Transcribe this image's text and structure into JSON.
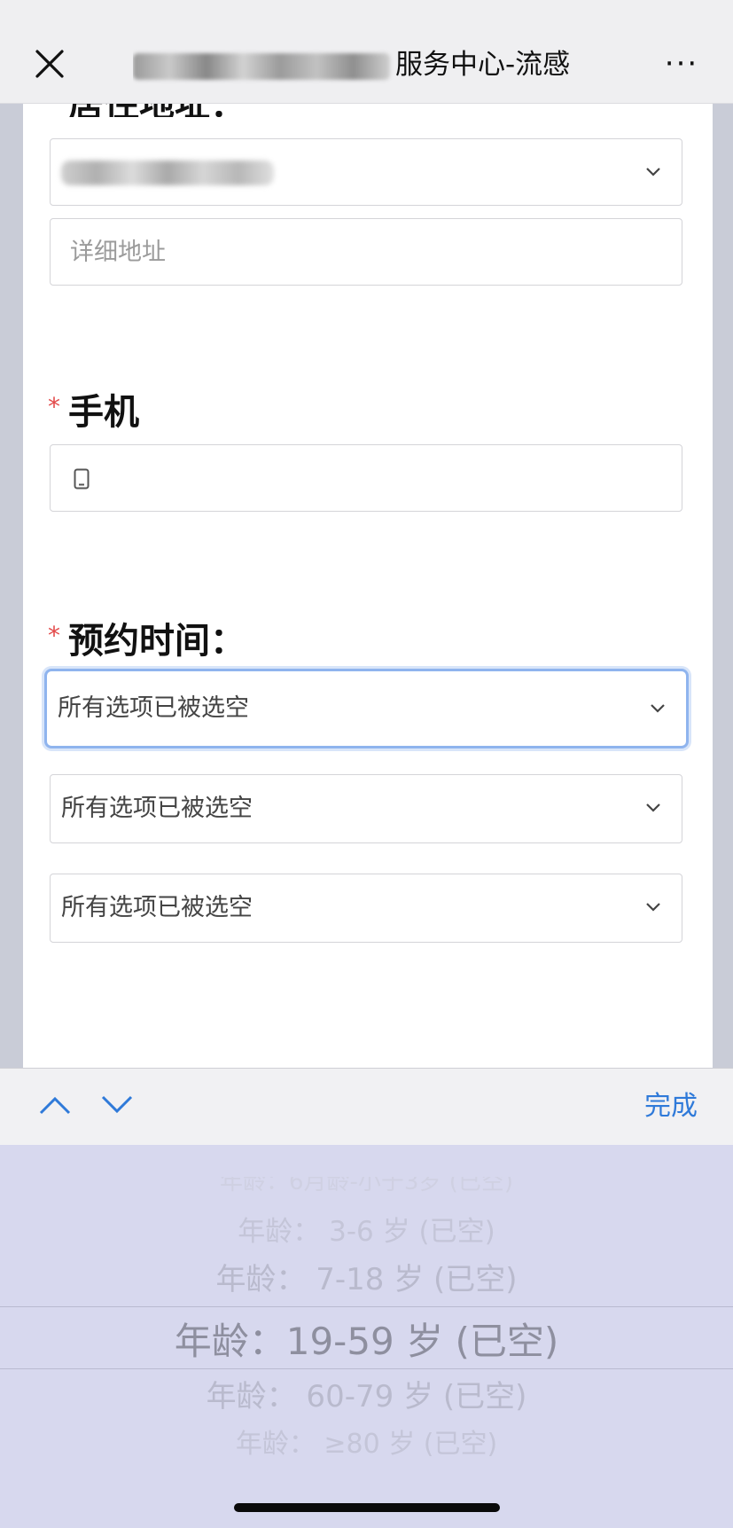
{
  "navbar": {
    "title": "服务中心-流感",
    "more": "···"
  },
  "form": {
    "address_label": "居住地址：",
    "address_detail_placeholder": "详细地址",
    "phone": {
      "required_mark": "*",
      "label": "手机"
    },
    "appointment": {
      "required_mark": "*",
      "label": "预约时间：",
      "selects": [
        "所有选项已被选空",
        "所有选项已被选空",
        "所有选项已被选空"
      ]
    }
  },
  "accessory_bar": {
    "done_label": "完成"
  },
  "picker": {
    "options": [
      "年龄：6月龄-小于3岁 (已空)",
      "年龄： 3-6 岁 (已空)",
      "年龄： 7-18 岁 (已空)",
      "年龄：19-59 岁 (已空)",
      "年龄： 60-79 岁 (已空)",
      "年龄： ≥80 岁 (已空)"
    ],
    "selected_index": 3
  },
  "colors": {
    "accent_blue": "#2f7ad9",
    "required_red": "#e34b4b",
    "focus_border": "#8fb4ee"
  }
}
